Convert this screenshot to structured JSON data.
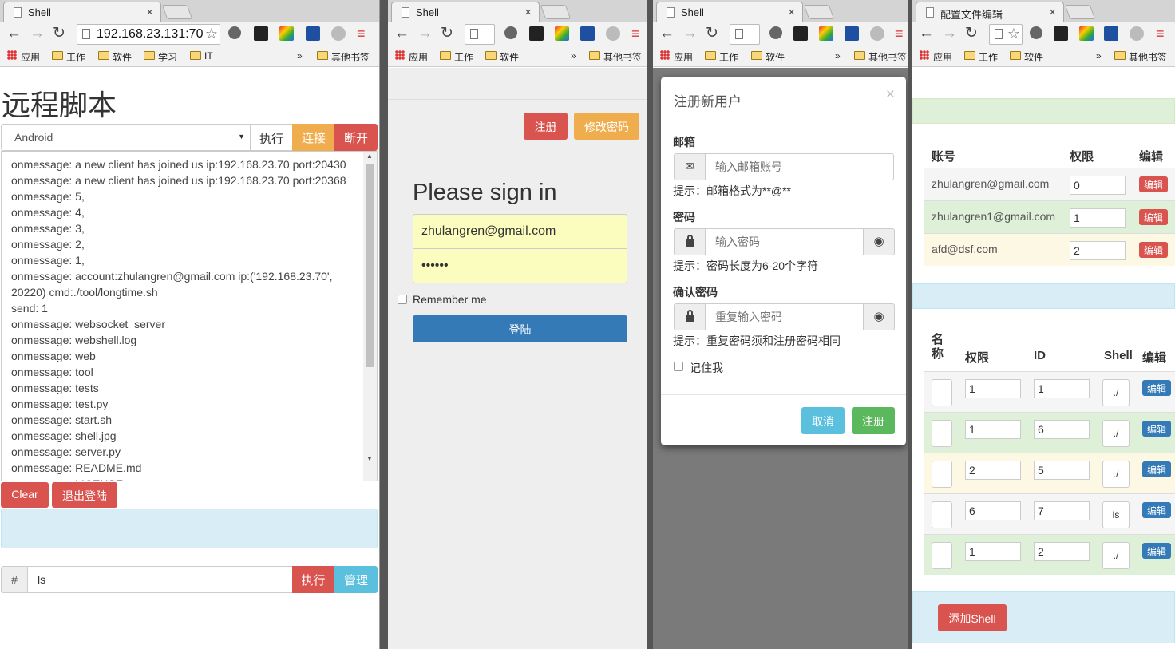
{
  "browser": {
    "bookmarks": {
      "apps": "应用",
      "work": "工作",
      "software": "软件",
      "study": "学习",
      "it": "IT",
      "more": "»",
      "others": "其他书签"
    },
    "address": "192.168.23.131:70"
  },
  "w1": {
    "tab": "Shell",
    "title": "远程脚本",
    "select": "Android",
    "exec": "执行",
    "connect": "连接",
    "disconnect": "断开",
    "log": [
      "onmessage: a new client has joined us ip:192.168.23.70 port:20430",
      "onmessage: a new client has joined us ip:192.168.23.70 port:20368",
      "onmessage: 5,",
      "onmessage: 4,",
      "onmessage: 3,",
      "onmessage: 2,",
      "onmessage: 1,",
      "onmessage: account:zhulangren@gmail.com ip:('192.168.23.70',",
      "20220) cmd:./tool/longtime.sh",
      "send: 1",
      "onmessage: websocket_server",
      "onmessage: webshell.log",
      "onmessage: web",
      "onmessage: tool",
      "onmessage: tests",
      "onmessage: test.py",
      "onmessage: start.sh",
      "onmessage: shell.jpg",
      "onmessage: server.py",
      "onmessage: README.md",
      "onmessage: LICENSE"
    ],
    "clear": "Clear",
    "logout": "退出登陆",
    "prompt": "#",
    "cmd": "ls",
    "exec2": "执行",
    "manage": "管理"
  },
  "w2": {
    "tab": "Shell",
    "register": "注册",
    "changepw": "修改密码",
    "heading": "Please sign in",
    "email": "zhulangren@gmail.com",
    "password": "••••••",
    "remember": "Remember me",
    "login": "登陆"
  },
  "w3": {
    "tab": "Shell",
    "modal_title": "注册新用户",
    "close": "×",
    "email_label": "邮箱",
    "email_ph": "输入邮箱账号",
    "email_hint": "提示：邮箱格式为**@**",
    "pw_label": "密码",
    "pw_ph": "输入密码",
    "pw_hint": "提示：密码长度为6-20个字符",
    "cpw_label": "确认密码",
    "cpw_ph": "重复输入密码",
    "cpw_hint": "提示：重复密码须和注册密码相同",
    "remember": "记住我",
    "cancel": "取消",
    "submit": "注册"
  },
  "w4": {
    "tab": "配置文件编辑",
    "users_header": {
      "account": "账号",
      "perm": "权限",
      "edit": "编辑"
    },
    "users": [
      {
        "account": "zhulangren@gmail.com",
        "perm": "0",
        "edit": "编辑"
      },
      {
        "account": "zhulangren1@gmail.com",
        "perm": "1",
        "edit": "编辑"
      },
      {
        "account": "afd@dsf.com",
        "perm": "2",
        "edit": "编辑"
      }
    ],
    "shells_header": {
      "name": "名称",
      "perm": "权限",
      "id": "ID",
      "shell": "Shell",
      "edit": "编辑"
    },
    "shells": [
      {
        "perm": "1",
        "id": "1",
        "shell": "./",
        "edit": "编辑"
      },
      {
        "perm": "1",
        "id": "6",
        "shell": "./",
        "edit": "编辑"
      },
      {
        "perm": "2",
        "id": "5",
        "shell": "./",
        "edit": "编辑"
      },
      {
        "perm": "6",
        "id": "7",
        "shell": "ls",
        "edit": "编辑"
      },
      {
        "perm": "1",
        "id": "2",
        "shell": "./",
        "edit": "编辑"
      }
    ],
    "add_shell": "添加Shell"
  },
  "colors": {
    "danger": "#d9534f",
    "warning": "#f0ad4e",
    "primary": "#337ab7",
    "info": "#5bc0de",
    "success": "#5cb85c"
  }
}
